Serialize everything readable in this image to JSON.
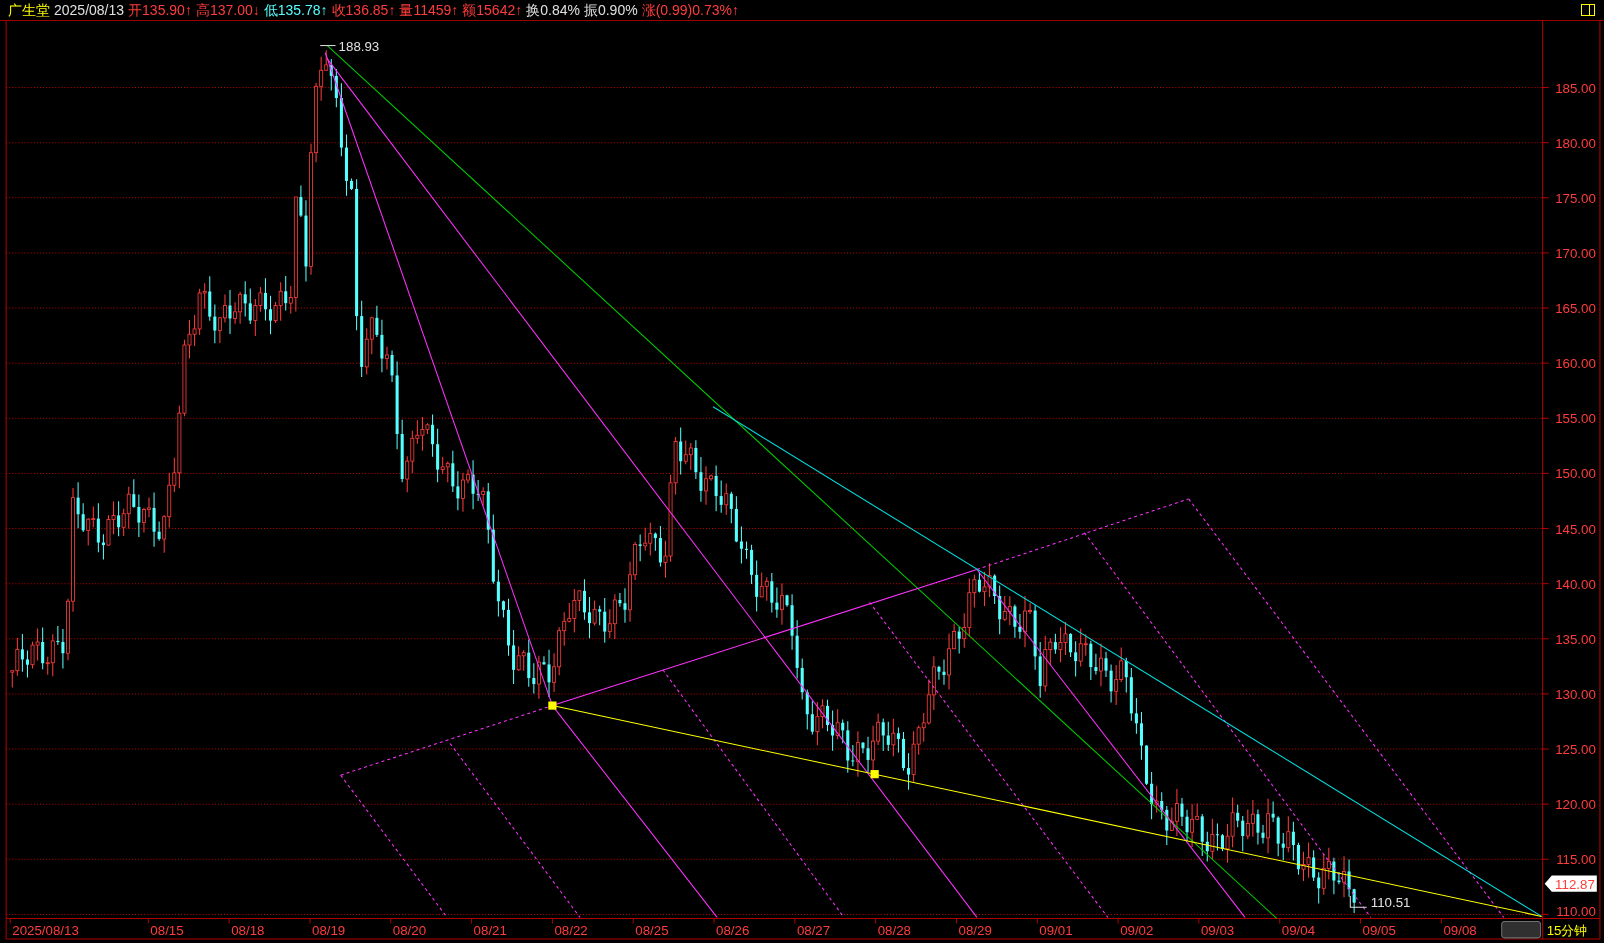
{
  "header": {
    "stock_name": "广生堂",
    "date": "2025/08/13",
    "quotes": [
      {
        "label": "开",
        "value": "135.90↑",
        "color": "#ff3c3c"
      },
      {
        "label": "高",
        "value": "137.00↓",
        "color": "#ff3c3c"
      },
      {
        "label": "低",
        "value": "135.78↑",
        "color": "#54ffff"
      },
      {
        "label": "收",
        "value": "136.85↑",
        "color": "#ff3c3c"
      },
      {
        "label": "量",
        "value": "11459↑",
        "color": "#ff3c3c"
      },
      {
        "label": "额",
        "value": "15642↑",
        "color": "#ff3c3c"
      },
      {
        "label": "换",
        "value": "0.84%",
        "color": "#e0e0e0"
      },
      {
        "label": "振",
        "value": "0.90%",
        "color": "#e0e0e0"
      },
      {
        "label": "涨",
        "value": "(0.99)0.73%↑",
        "color": "#ff3c3c"
      }
    ]
  },
  "price_axis": [
    "185.00",
    "180.00",
    "175.00",
    "170.00",
    "165.00",
    "160.00",
    "155.00",
    "150.00",
    "145.00",
    "140.00",
    "135.00",
    "130.00",
    "125.00",
    "120.00",
    "115.00",
    "110.00"
  ],
  "date_axis": [
    "2025/08/13",
    "08/15",
    "08/18",
    "08/19",
    "08/20",
    "08/21",
    "08/22",
    "08/25",
    "08/26",
    "08/27",
    "08/28",
    "08/29",
    "09/01",
    "09/02",
    "09/03",
    "09/04",
    "09/05",
    "09/08"
  ],
  "high_marker": "188.93",
  "low_marker": "110.51",
  "last_price": "112.87",
  "period": "15分钟"
}
